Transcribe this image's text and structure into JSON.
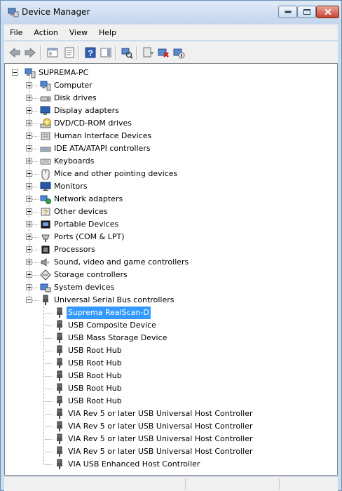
{
  "window": {
    "title": "Device Manager"
  },
  "menu": [
    "File",
    "Action",
    "View",
    "Help"
  ],
  "toolbar": [
    {
      "icon": "back-arrow-icon"
    },
    {
      "icon": "forward-arrow-icon"
    },
    {
      "icon": "console-tree-icon"
    },
    {
      "icon": "properties-icon"
    },
    {
      "icon": "help-icon"
    },
    {
      "icon": "action-pane-icon"
    },
    {
      "icon": "scan-hardware-icon"
    },
    {
      "icon": "update-driver-icon"
    },
    {
      "icon": "uninstall-icon"
    },
    {
      "icon": "disable-device-icon"
    }
  ],
  "tree": {
    "root": {
      "label": "SUPREMA-PC",
      "icon": "computer-icon"
    },
    "categories": [
      {
        "label": "Computer",
        "icon": "computer-icon"
      },
      {
        "label": "Disk drives",
        "icon": "disk-drive-icon"
      },
      {
        "label": "Display adapters",
        "icon": "display-adapter-icon"
      },
      {
        "label": "DVD/CD-ROM drives",
        "icon": "dvd-drive-icon"
      },
      {
        "label": "Human Interface Devices",
        "icon": "hid-icon"
      },
      {
        "label": "IDE ATA/ATAPI controllers",
        "icon": "ide-controller-icon"
      },
      {
        "label": "Keyboards",
        "icon": "keyboard-icon"
      },
      {
        "label": "Mice and other pointing devices",
        "icon": "mouse-icon"
      },
      {
        "label": "Monitors",
        "icon": "monitor-icon"
      },
      {
        "label": "Network adapters",
        "icon": "network-adapter-icon"
      },
      {
        "label": "Other devices",
        "icon": "unknown-device-icon"
      },
      {
        "label": "Portable Devices",
        "icon": "portable-device-icon"
      },
      {
        "label": "Ports (COM & LPT)",
        "icon": "port-icon"
      },
      {
        "label": "Processors",
        "icon": "processor-icon"
      },
      {
        "label": "Sound, video and game controllers",
        "icon": "sound-icon"
      },
      {
        "label": "Storage controllers",
        "icon": "storage-controller-icon"
      },
      {
        "label": "System devices",
        "icon": "system-device-icon"
      },
      {
        "label": "Universal Serial Bus controllers",
        "icon": "usb-icon",
        "expanded": true
      }
    ],
    "usb_devices": [
      {
        "label": "Suprema RealScan-D",
        "selected": true
      },
      {
        "label": "USB Composite Device"
      },
      {
        "label": "USB Mass Storage Device"
      },
      {
        "label": "USB Root Hub"
      },
      {
        "label": "USB Root Hub"
      },
      {
        "label": "USB Root Hub"
      },
      {
        "label": "USB Root Hub"
      },
      {
        "label": "USB Root Hub"
      },
      {
        "label": "VIA Rev 5 or later USB Universal Host Controller"
      },
      {
        "label": "VIA Rev 5 or later USB Universal Host Controller"
      },
      {
        "label": "VIA Rev 5 or later USB Universal Host Controller"
      },
      {
        "label": "VIA Rev 5 or later USB Universal Host Controller"
      },
      {
        "label": "VIA USB Enhanced Host Controller"
      }
    ]
  },
  "colors": {
    "selection": "#3399ff",
    "titlebar": "#c9dcef"
  }
}
